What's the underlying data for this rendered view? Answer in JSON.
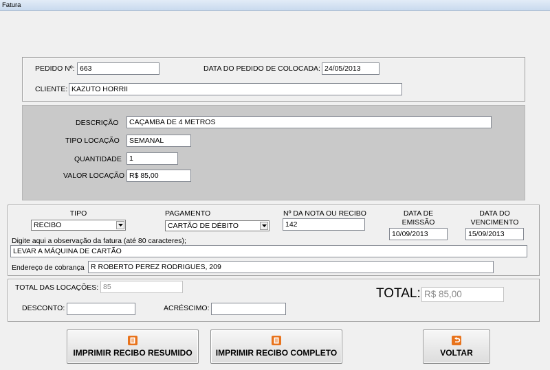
{
  "window": {
    "title": "Fatura"
  },
  "order": {
    "pedido_label": "PEDIDO Nº:",
    "pedido_value": "663",
    "data_label": "DATA DO PEDIDO DE COLOCADA:",
    "data_value": "24/05/2013",
    "cliente_label": "CLIENTE:",
    "cliente_value": "KAZUTO HORRII"
  },
  "item": {
    "descricao_label": "DESCRIÇÃO",
    "descricao_value": "CAÇAMBA DE 4 METROS",
    "tipo_locacao_label": "TIPO LOCAÇÃO",
    "tipo_locacao_value": "SEMANAL",
    "quantidade_label": "QUANTIDADE",
    "quantidade_value": "1",
    "valor_label": "VALOR LOCAÇÃO",
    "valor_value": "R$ 85,00"
  },
  "invoice": {
    "tipo_label": "TIPO",
    "tipo_value": "RECIBO",
    "pagamento_label": "PAGAMENTO",
    "pagamento_value": "CARTÃO DE DÉBITO",
    "nota_label": "Nº DA NOTA OU RECIBO",
    "nota_value": "142",
    "emissao_label_1": "DATA DE",
    "emissao_label_2": "EMISSÃO",
    "emissao_value": "10/09/2013",
    "vencimento_label_1": "DATA DO",
    "vencimento_label_2": "VENCIMENTO",
    "vencimento_value": "15/09/2013",
    "obs_label": "Digite aqui a observação da fatura (até 80 caracteres);",
    "obs_value": "LEVAR A MÁQUINA DE CARTÃO",
    "endereco_label": "Endereço de cobrança",
    "endereco_value": "R ROBERTO PEREZ RODRIGUES, 209"
  },
  "totals": {
    "total_locacoes_label": "TOTAL DAS LOCAÇÕES:",
    "total_locacoes_value": "85",
    "desconto_label": "DESCONTO:",
    "desconto_value": "",
    "acrescimo_label": "ACRÉSCIMO:",
    "acrescimo_value": "",
    "total_label": "TOTAL:",
    "total_value": "R$ 85,00"
  },
  "buttons": {
    "resumido": "IMPRIMIR RECIBO RESUMIDO",
    "completo": "IMPRIMIR RECIBO COMPLETO",
    "voltar": "VOLTAR"
  },
  "colors": {
    "icon_orange": "#e8731c"
  }
}
